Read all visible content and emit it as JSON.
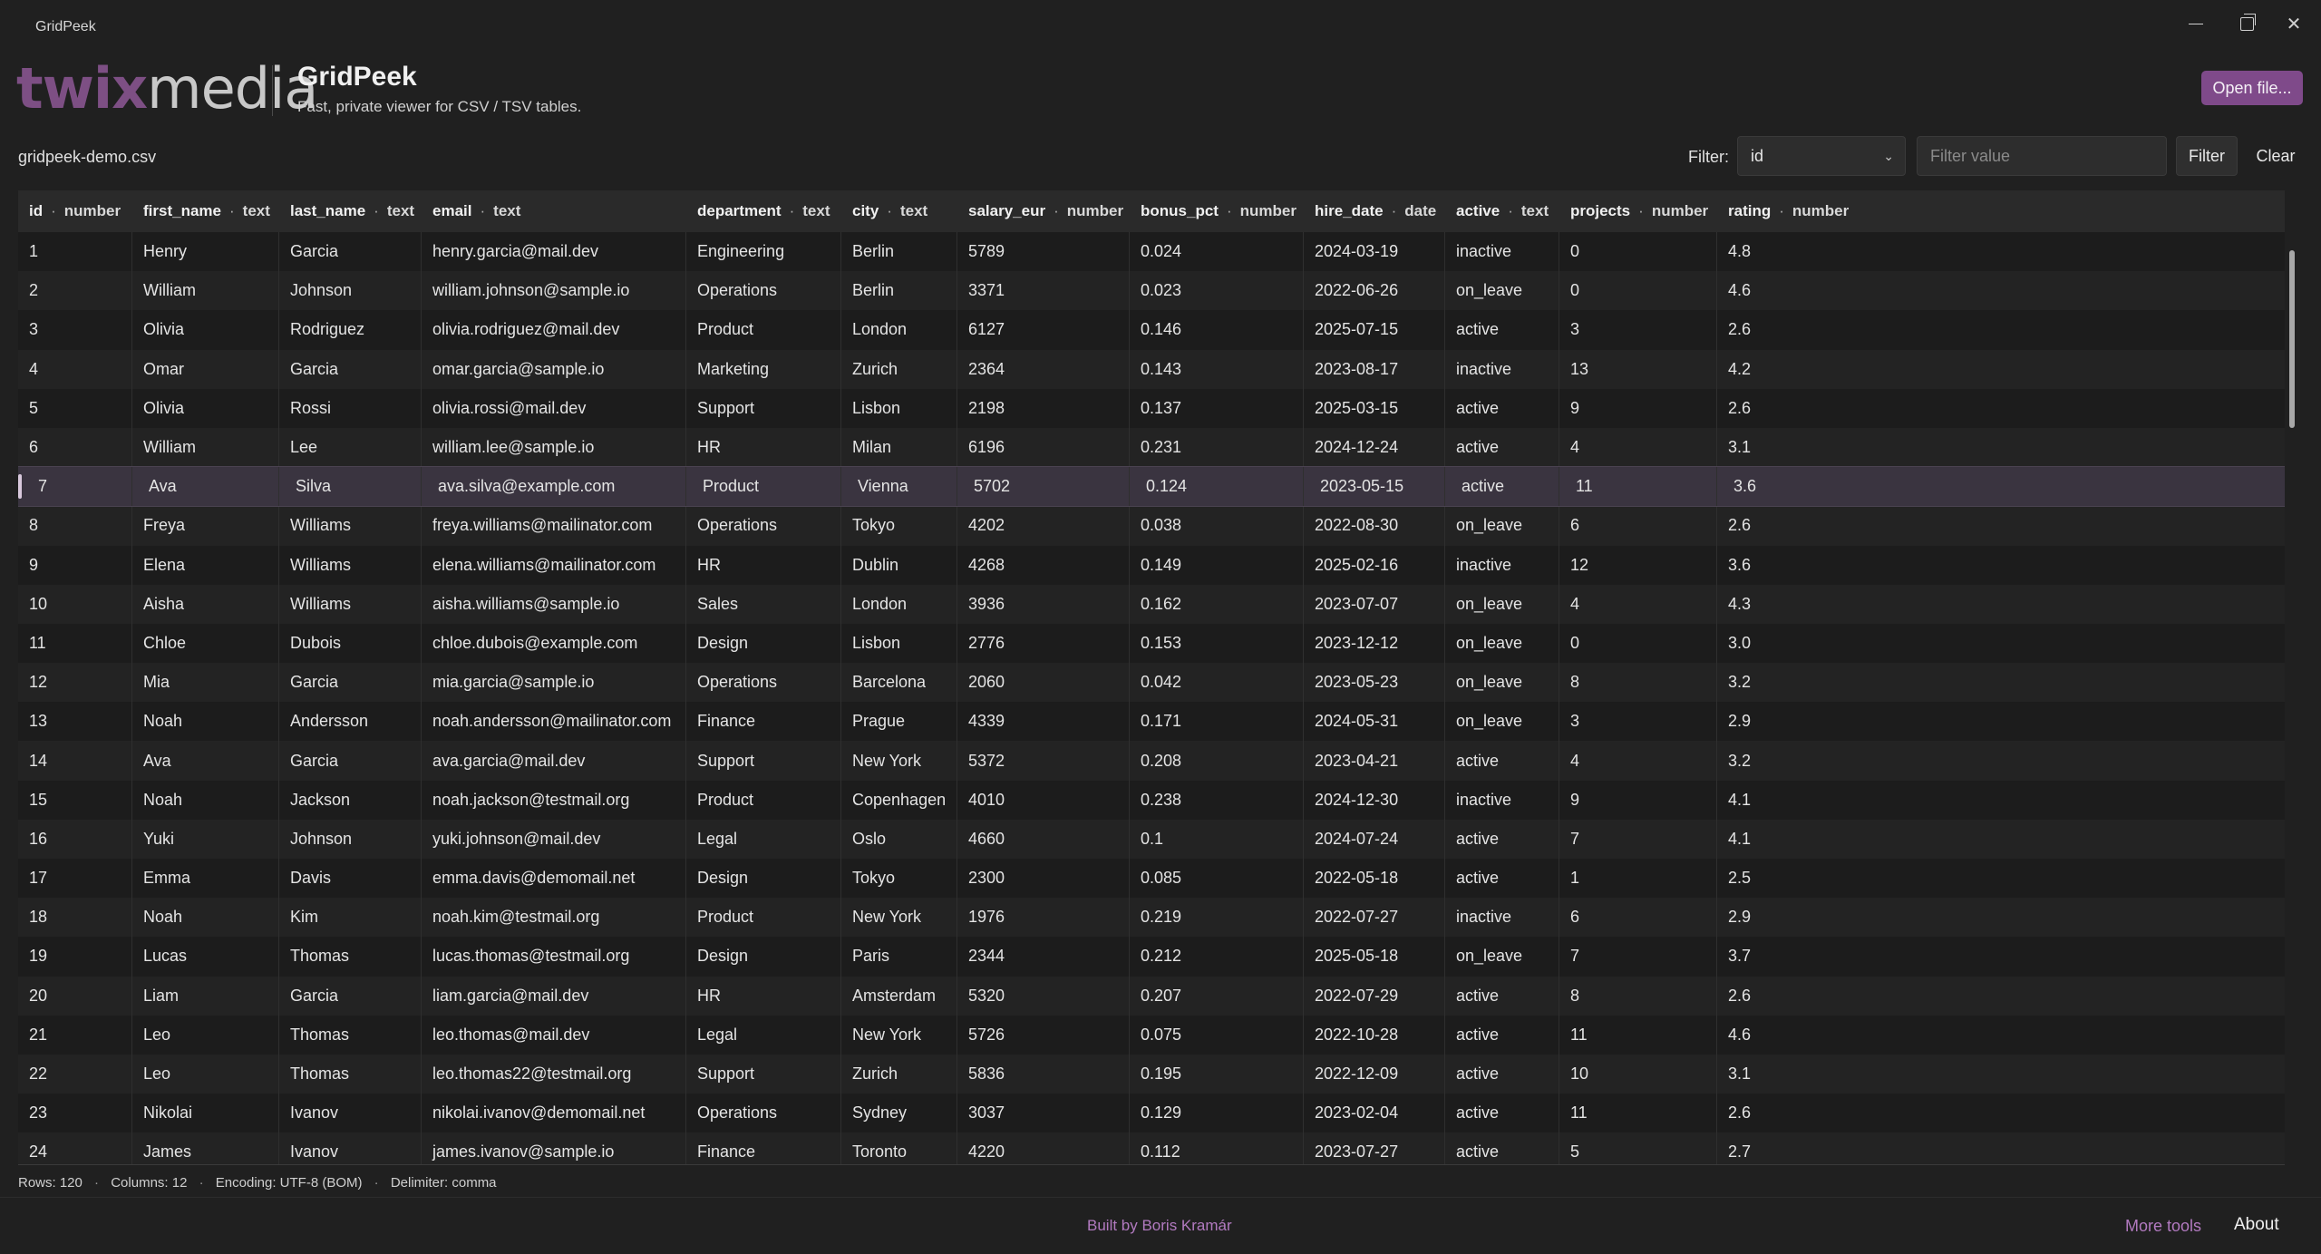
{
  "window": {
    "title": "GridPeek"
  },
  "header": {
    "logo_part1": "twix",
    "logo_part2": "media",
    "title": "GridPeek",
    "subtitle": "Fast, private viewer for CSV / TSV tables.",
    "open_label": "Open file..."
  },
  "toolbar": {
    "file_name": "gridpeek-demo.csv",
    "filter_label": "Filter:",
    "filter_column": "id",
    "filter_placeholder": "Filter value",
    "filter_button": "Filter",
    "clear_button": "Clear"
  },
  "grid": {
    "columns": [
      {
        "name": "id",
        "type": "number"
      },
      {
        "name": "first_name",
        "type": "text"
      },
      {
        "name": "last_name",
        "type": "text"
      },
      {
        "name": "email",
        "type": "text"
      },
      {
        "name": "department",
        "type": "text"
      },
      {
        "name": "city",
        "type": "text"
      },
      {
        "name": "salary_eur",
        "type": "number"
      },
      {
        "name": "bonus_pct",
        "type": "number"
      },
      {
        "name": "hire_date",
        "type": "date"
      },
      {
        "name": "active",
        "type": "text"
      },
      {
        "name": "projects",
        "type": "number"
      },
      {
        "name": "rating",
        "type": "number"
      }
    ],
    "selected_id": "7",
    "rows": [
      [
        "1",
        "Henry",
        "Garcia",
        "henry.garcia@mail.dev",
        "Engineering",
        "Berlin",
        "5789",
        "0.024",
        "2024-03-19",
        "inactive",
        "0",
        "4.8"
      ],
      [
        "2",
        "William",
        "Johnson",
        "william.johnson@sample.io",
        "Operations",
        "Berlin",
        "3371",
        "0.023",
        "2022-06-26",
        "on_leave",
        "0",
        "4.6"
      ],
      [
        "3",
        "Olivia",
        "Rodriguez",
        "olivia.rodriguez@mail.dev",
        "Product",
        "London",
        "6127",
        "0.146",
        "2025-07-15",
        "active",
        "3",
        "2.6"
      ],
      [
        "4",
        "Omar",
        "Garcia",
        "omar.garcia@sample.io",
        "Marketing",
        "Zurich",
        "2364",
        "0.143",
        "2023-08-17",
        "inactive",
        "13",
        "4.2"
      ],
      [
        "5",
        "Olivia",
        "Rossi",
        "olivia.rossi@mail.dev",
        "Support",
        "Lisbon",
        "2198",
        "0.137",
        "2025-03-15",
        "active",
        "9",
        "2.6"
      ],
      [
        "6",
        "William",
        "Lee",
        "william.lee@sample.io",
        "HR",
        "Milan",
        "6196",
        "0.231",
        "2024-12-24",
        "active",
        "4",
        "3.1"
      ],
      [
        "7",
        "Ava",
        "Silva",
        "ava.silva@example.com",
        "Product",
        "Vienna",
        "5702",
        "0.124",
        "2023-05-15",
        "active",
        "11",
        "3.6"
      ],
      [
        "8",
        "Freya",
        "Williams",
        "freya.williams@mailinator.com",
        "Operations",
        "Tokyo",
        "4202",
        "0.038",
        "2022-08-30",
        "on_leave",
        "6",
        "2.6"
      ],
      [
        "9",
        "Elena",
        "Williams",
        "elena.williams@mailinator.com",
        "HR",
        "Dublin",
        "4268",
        "0.149",
        "2025-02-16",
        "inactive",
        "12",
        "3.6"
      ],
      [
        "10",
        "Aisha",
        "Williams",
        "aisha.williams@sample.io",
        "Sales",
        "London",
        "3936",
        "0.162",
        "2023-07-07",
        "on_leave",
        "4",
        "4.3"
      ],
      [
        "11",
        "Chloe",
        "Dubois",
        "chloe.dubois@example.com",
        "Design",
        "Lisbon",
        "2776",
        "0.153",
        "2023-12-12",
        "on_leave",
        "0",
        "3.0"
      ],
      [
        "12",
        "Mia",
        "Garcia",
        "mia.garcia@sample.io",
        "Operations",
        "Barcelona",
        "2060",
        "0.042",
        "2023-05-23",
        "on_leave",
        "8",
        "3.2"
      ],
      [
        "13",
        "Noah",
        "Andersson",
        "noah.andersson@mailinator.com",
        "Finance",
        "Prague",
        "4339",
        "0.171",
        "2024-05-31",
        "on_leave",
        "3",
        "2.9"
      ],
      [
        "14",
        "Ava",
        "Garcia",
        "ava.garcia@mail.dev",
        "Support",
        "New York",
        "5372",
        "0.208",
        "2023-04-21",
        "active",
        "4",
        "3.2"
      ],
      [
        "15",
        "Noah",
        "Jackson",
        "noah.jackson@testmail.org",
        "Product",
        "Copenhagen",
        "4010",
        "0.238",
        "2024-12-30",
        "inactive",
        "9",
        "4.1"
      ],
      [
        "16",
        "Yuki",
        "Johnson",
        "yuki.johnson@mail.dev",
        "Legal",
        "Oslo",
        "4660",
        "0.1",
        "2024-07-24",
        "active",
        "7",
        "4.1"
      ],
      [
        "17",
        "Emma",
        "Davis",
        "emma.davis@demomail.net",
        "Design",
        "Tokyo",
        "2300",
        "0.085",
        "2022-05-18",
        "active",
        "1",
        "2.5"
      ],
      [
        "18",
        "Noah",
        "Kim",
        "noah.kim@testmail.org",
        "Product",
        "New York",
        "1976",
        "0.219",
        "2022-07-27",
        "inactive",
        "6",
        "2.9"
      ],
      [
        "19",
        "Lucas",
        "Thomas",
        "lucas.thomas@testmail.org",
        "Design",
        "Paris",
        "2344",
        "0.212",
        "2025-05-18",
        "on_leave",
        "7",
        "3.7"
      ],
      [
        "20",
        "Liam",
        "Garcia",
        "liam.garcia@mail.dev",
        "HR",
        "Amsterdam",
        "5320",
        "0.207",
        "2022-07-29",
        "active",
        "8",
        "2.6"
      ],
      [
        "21",
        "Leo",
        "Thomas",
        "leo.thomas@mail.dev",
        "Legal",
        "New York",
        "5726",
        "0.075",
        "2022-10-28",
        "active",
        "11",
        "4.6"
      ],
      [
        "22",
        "Leo",
        "Thomas",
        "leo.thomas22@testmail.org",
        "Support",
        "Zurich",
        "5836",
        "0.195",
        "2022-12-09",
        "active",
        "10",
        "3.1"
      ],
      [
        "23",
        "Nikolai",
        "Ivanov",
        "nikolai.ivanov@demomail.net",
        "Operations",
        "Sydney",
        "3037",
        "0.129",
        "2023-02-04",
        "active",
        "11",
        "2.6"
      ],
      [
        "24",
        "James",
        "Ivanov",
        "james.ivanov@sample.io",
        "Finance",
        "Toronto",
        "4220",
        "0.112",
        "2023-07-27",
        "active",
        "5",
        "2.7"
      ]
    ]
  },
  "status": {
    "rows": "Rows: 120",
    "columns": "Columns: 12",
    "encoding": "Encoding: UTF-8 (BOM)",
    "delimiter": "Delimiter: comma",
    "separator": "·"
  },
  "footer": {
    "credit": "Built by Boris Kramár",
    "more_tools": "More tools",
    "about": "About"
  },
  "colors": {
    "accent": "#7f4a8a",
    "link": "#b27ac0",
    "background": "#202020",
    "selected_row": "#3a3440"
  }
}
